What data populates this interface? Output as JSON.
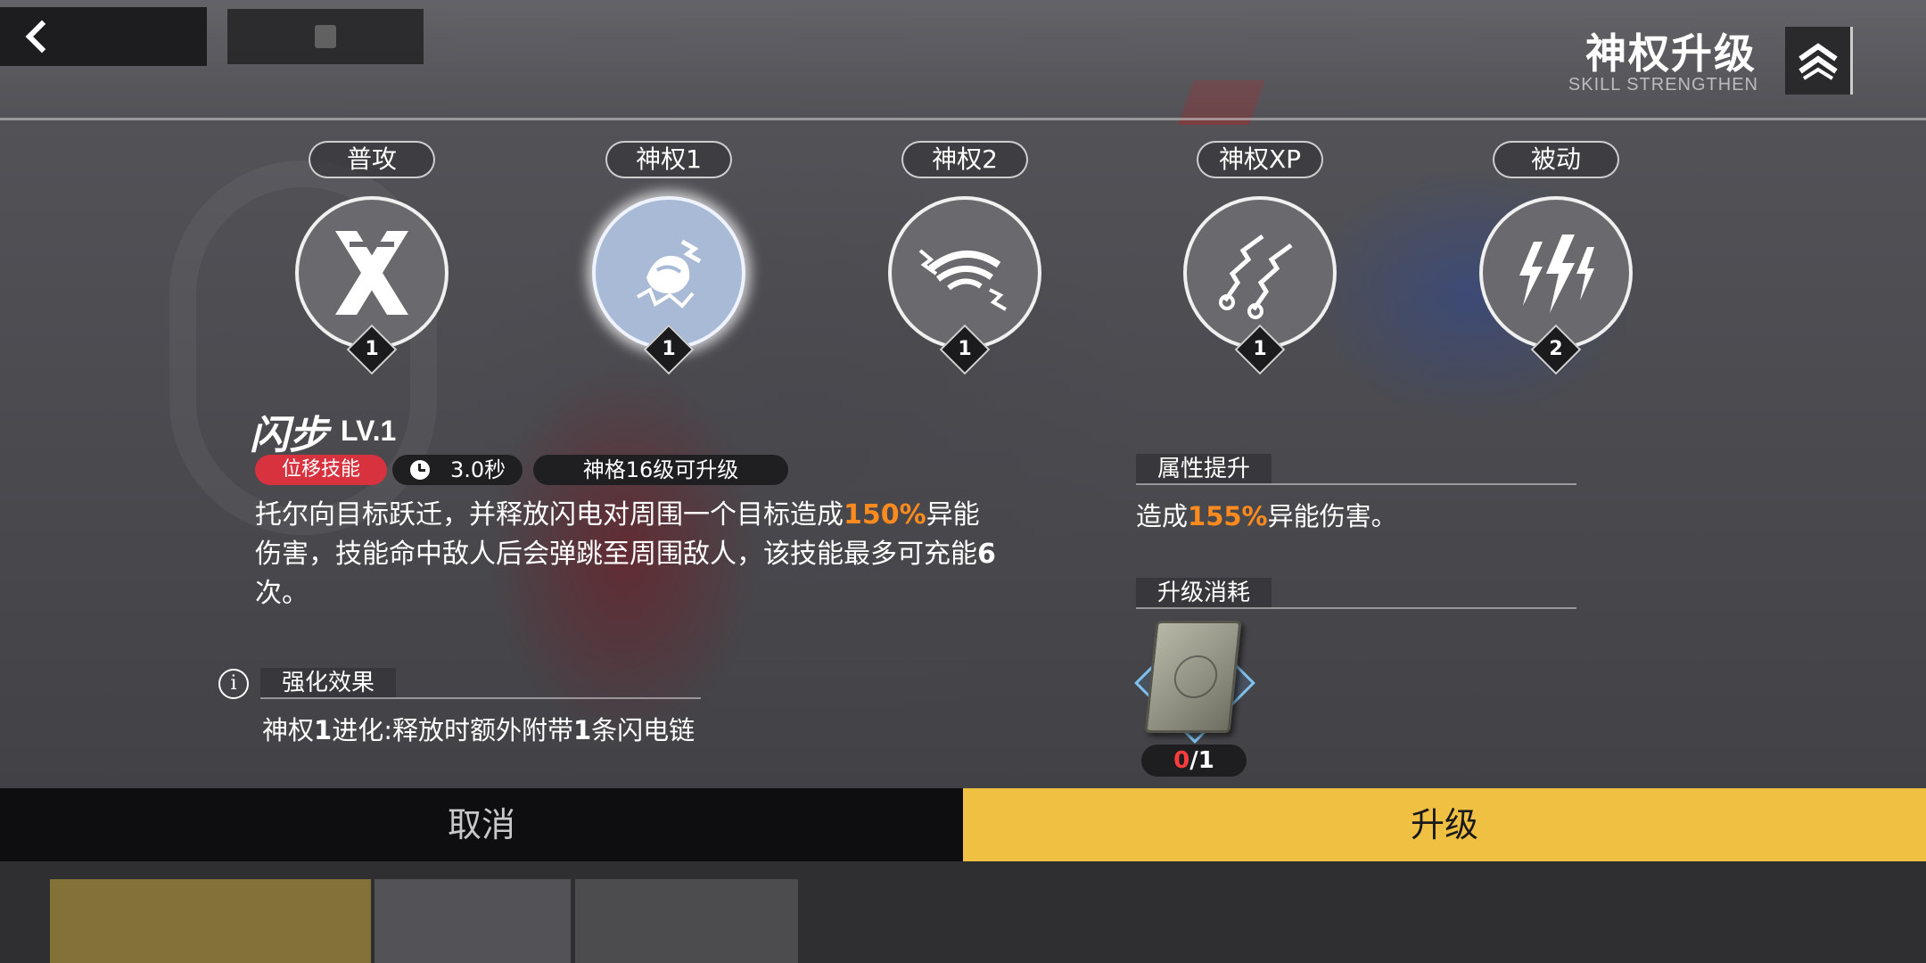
{
  "header": {
    "title": "神权升级",
    "subtitle": "SKILL STRENGTHEN"
  },
  "skills": [
    {
      "tab": "普攻",
      "level": "1",
      "icon": "crossed-blades-icon"
    },
    {
      "tab": "神权1",
      "level": "1",
      "icon": "lightning-dash-icon",
      "active": true
    },
    {
      "tab": "神权2",
      "level": "1",
      "icon": "lightning-vortex-icon"
    },
    {
      "tab": "神权XP",
      "level": "1",
      "icon": "lightning-hammers-icon"
    },
    {
      "tab": "被动",
      "level": "2",
      "icon": "lightning-bolts-icon"
    }
  ],
  "detail": {
    "name": "闪步",
    "level": "LV.1",
    "type_tag": "位移技能",
    "cooldown": "3.0秒",
    "requirement": "神格16级可升级",
    "desc_part1": "托尔向目标跃迁，并释放闪电对周围一个目标造成",
    "desc_hl": "150%",
    "desc_part2": "异能伤害，技能命中敌人后会弹跳至周围敌人，该技能最多可充能",
    "desc_bold": "6",
    "desc_part3": "次。"
  },
  "enhancement": {
    "label": "强化效果",
    "text_a": "神权",
    "text_b": "1",
    "text_c": "进化:释放时额外附带",
    "text_d": "1",
    "text_e": "条闪电链"
  },
  "attribute": {
    "label": "属性提升",
    "text_a": "造成",
    "text_hl": "155%",
    "text_b": "异能伤害。"
  },
  "cost": {
    "label": "升级消耗",
    "item_icon": "rune-book-icon",
    "have": "0",
    "need": "/1"
  },
  "buttons": {
    "cancel": "取消",
    "upgrade": "升级"
  },
  "colors": {
    "accent_yellow": "#f0c042",
    "highlight_orange": "#ff8a1e",
    "tag_red": "#d7323e",
    "active_skill_blue": "#a9bad6"
  }
}
